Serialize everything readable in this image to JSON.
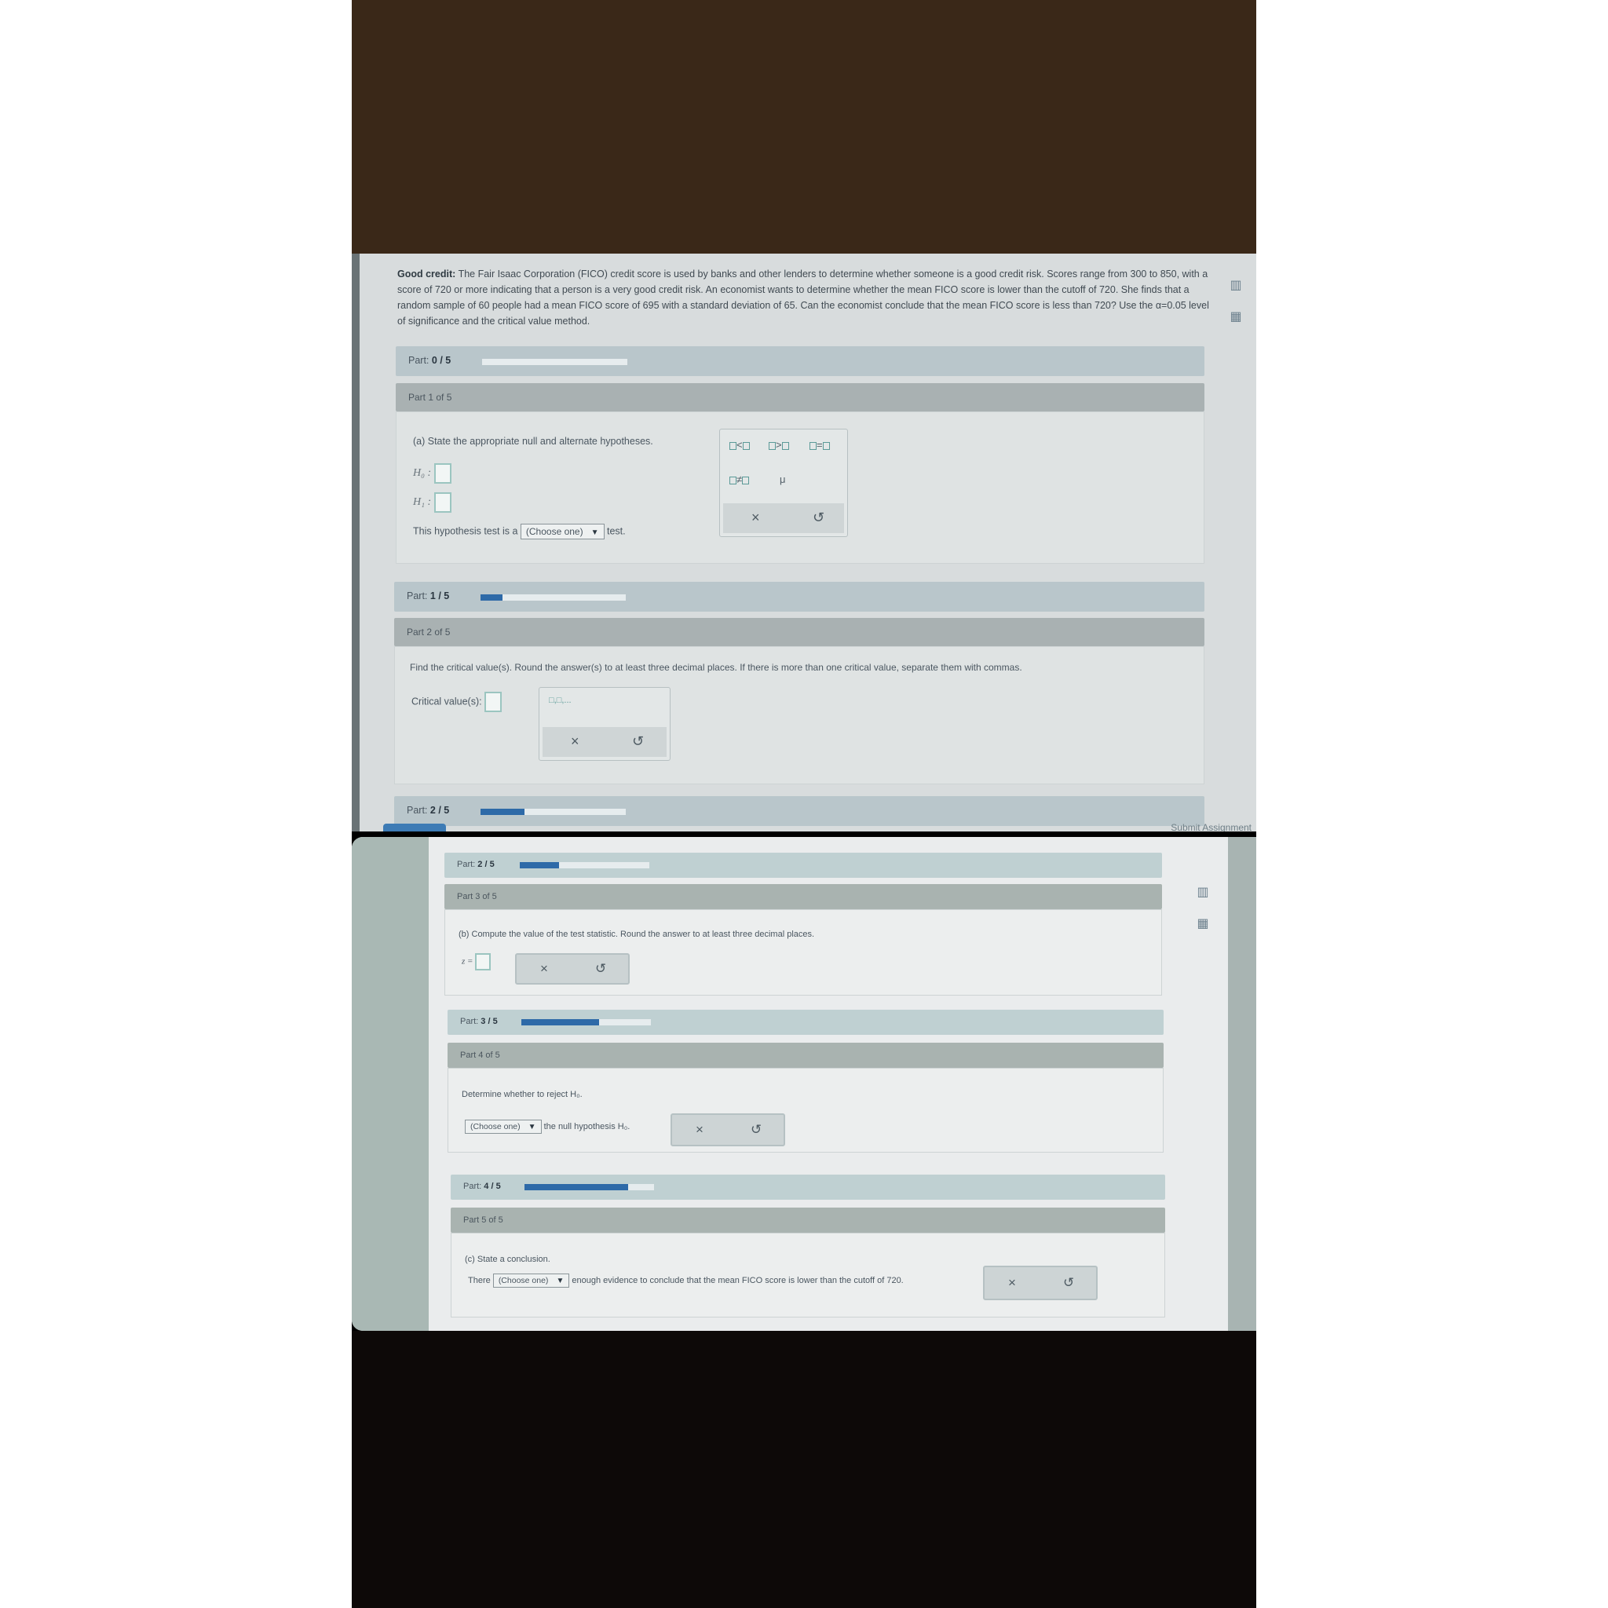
{
  "problem": {
    "title": "Good credit:",
    "text": "The Fair Isaac Corporation (FICO) credit score is used by banks and other lenders to determine whether someone is a good credit risk. Scores range from 300 to 850, with a score of 720 or more indicating that a person is a very good credit risk. An economist wants to determine whether the mean FICO score is lower than the cutoff of 720. She finds that a random sample of 60 people had a mean FICO score of 695 with a standard deviation of 65. Can the economist conclude that the mean FICO score is less than 720? Use the α=0.05 level of significance and the critical value method."
  },
  "icons": {
    "chart": "chart-icon",
    "calculator": "calculator-icon",
    "close": "x-icon",
    "undo": "undo-icon"
  },
  "progress": {
    "label": "Part:",
    "p0": {
      "count": "0 / 5",
      "fraction": 0.0
    },
    "p1": {
      "count": "1 / 5",
      "fraction": 0.15
    },
    "p2": {
      "count": "2 / 5",
      "fraction": 0.3
    },
    "p3": {
      "count": "3 / 5",
      "fraction": 0.6
    },
    "p4": {
      "count": "4 / 5",
      "fraction": 0.8
    }
  },
  "part1": {
    "header": "Part 1 of 5",
    "question": "(a) State the appropriate null and alternate hypotheses.",
    "h0": "H₀ :",
    "h1": "H₁ :",
    "test_prefix": "This hypothesis test is a",
    "test_select": "(Choose one)",
    "test_suffix": "test.",
    "palette": {
      "lt": "<",
      "gt": ">",
      "eq": "=",
      "ne": "≠",
      "mu": "μ"
    }
  },
  "part2": {
    "header": "Part 2 of 5",
    "question": "Find the critical value(s). Round the answer(s) to at least three decimal places. If there is more than one critical value, separate them with commas.",
    "label": "Critical value(s):",
    "palette_sym": "□,□,..."
  },
  "part3": {
    "header": "Part 3 of 5",
    "question": "(b) Compute the value of the test statistic. Round the answer to at least three decimal places.",
    "label": "z ="
  },
  "part4": {
    "header": "Part 4 of 5",
    "question": "Determine whether to reject H₀.",
    "select": "(Choose one)",
    "suffix": "the null hypothesis H₀."
  },
  "part5": {
    "header": "Part 5 of 5",
    "question": "(c) State a conclusion.",
    "prefix": "There",
    "select": "(Choose one)",
    "suffix": "enough evidence to conclude that the mean FICO score is lower than the cutoff of 720."
  },
  "submit_label": "Submit Assignment"
}
